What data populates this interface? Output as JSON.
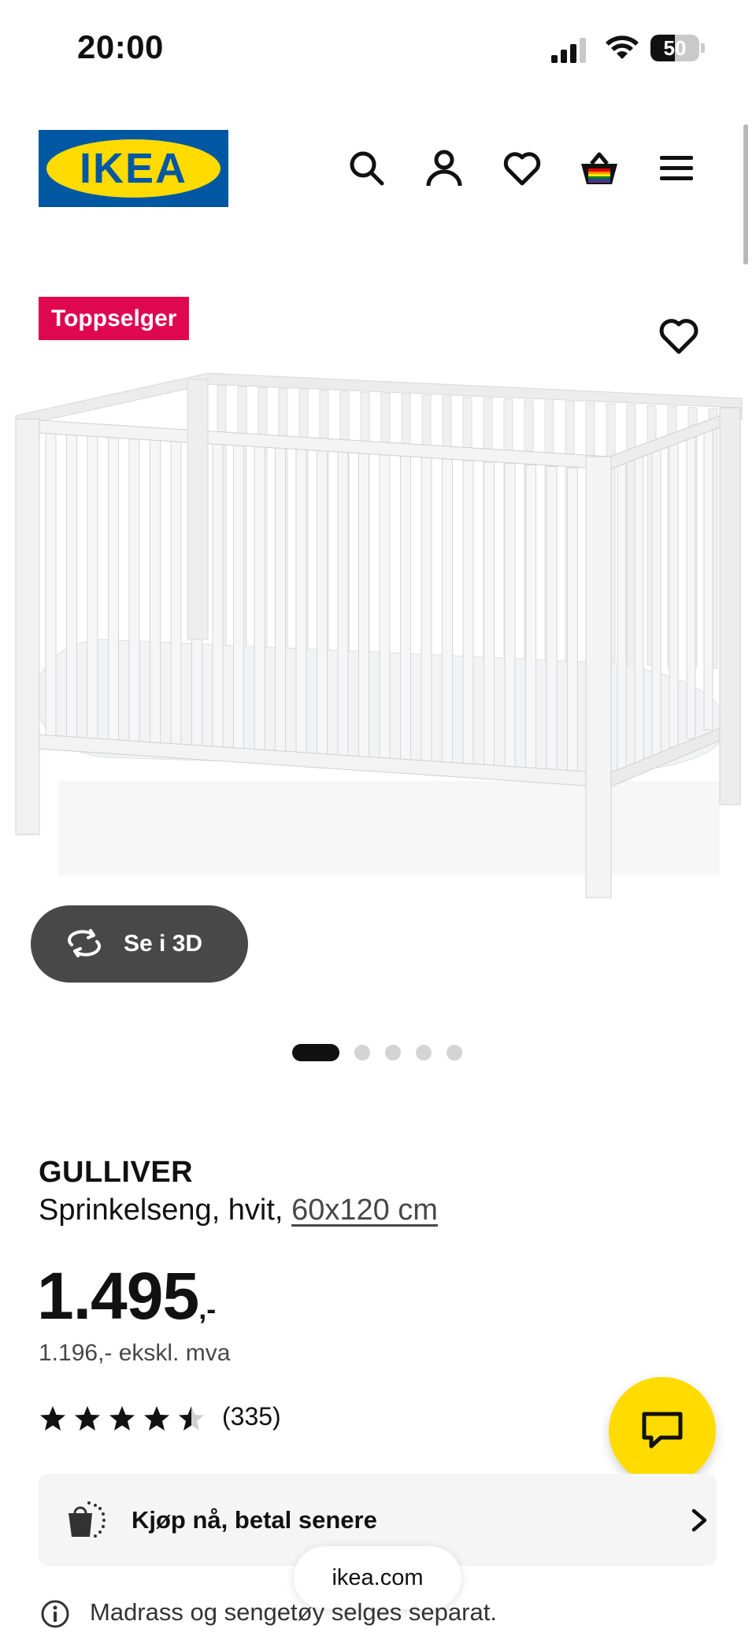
{
  "status_bar": {
    "time": "20:00",
    "battery_percent": 50,
    "battery_label": "50"
  },
  "header": {
    "logo_text": "IKEA",
    "nav_icons": [
      "search-icon",
      "account-icon",
      "heart-icon",
      "basket-icon",
      "menu-icon"
    ]
  },
  "gallery": {
    "badge": "Toppselger",
    "view_3d_label": "Se i 3D",
    "image_count": 5,
    "active_index": 0
  },
  "product": {
    "name": "GULLIVER",
    "description": "Sprinkelseng, hvit,",
    "size": "60x120 cm",
    "price": "1.495",
    "price_suffix": ",-",
    "price_ex_vat": "1.196,- ekskl. mva",
    "rating": 4.5,
    "rating_max": 5,
    "review_count": "(335)"
  },
  "pay_later": {
    "label": "Kjøp nå, betal senere"
  },
  "browser": {
    "domain": "ikea.com"
  },
  "notice": {
    "text": "Madrass og sengetøy selges separat."
  },
  "colors": {
    "ikea_blue": "#0058a3",
    "ikea_yellow": "#ffdb00",
    "badge_red": "#e00751",
    "dark_button": "#484848"
  }
}
